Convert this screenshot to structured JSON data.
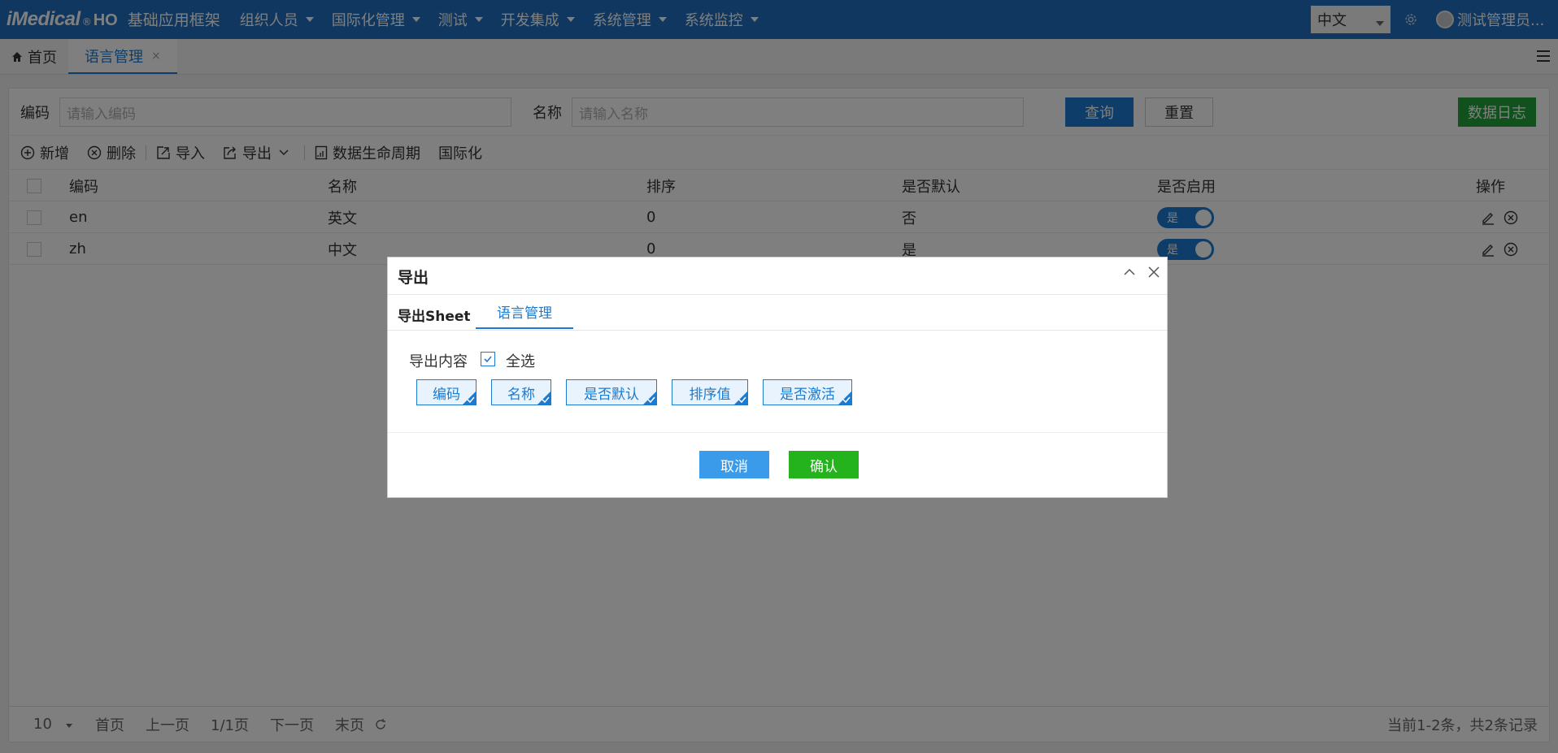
{
  "topbar": {
    "logo": "iMedical",
    "registered": "®",
    "product": "HO",
    "app_name": "基础应用框架",
    "menu": [
      {
        "label": "组织人员"
      },
      {
        "label": "国际化管理"
      },
      {
        "label": "测试"
      },
      {
        "label": "开发集成"
      },
      {
        "label": "系统管理"
      },
      {
        "label": "系统监控"
      }
    ],
    "language": "中文",
    "user": "测试管理员..."
  },
  "tabs": {
    "home": "首页",
    "active": "语言管理",
    "close": "×"
  },
  "search": {
    "code_label": "编码",
    "code_placeholder": "请输入编码",
    "name_label": "名称",
    "name_placeholder": "请输入名称",
    "query": "查询",
    "reset": "重置",
    "data_log": "数据日志"
  },
  "toolbar": {
    "add": "新增",
    "delete": "删除",
    "import": "导入",
    "export": "导出",
    "lifecycle": "数据生命周期",
    "i18n": "国际化"
  },
  "table": {
    "headers": {
      "code": "编码",
      "name": "名称",
      "sort": "排序",
      "is_default": "是否默认",
      "enabled": "是否启用",
      "actions": "操作"
    },
    "rows": [
      {
        "code": "en",
        "name": "英文",
        "sort": "0",
        "is_default": "否",
        "enabled": "是"
      },
      {
        "code": "zh",
        "name": "中文",
        "sort": "0",
        "is_default": "是",
        "enabled": "是"
      }
    ]
  },
  "pager": {
    "page_size": "10",
    "first": "首页",
    "prev": "上一页",
    "page": "1/1页",
    "next": "下一页",
    "last": "末页",
    "summary": "当前1-2条，共2条记录"
  },
  "dialog": {
    "title": "导出",
    "sheet_label": "导出Sheet",
    "sheet_tab": "语言管理",
    "content_label": "导出内容",
    "select_all": "全选",
    "fields": [
      "编码",
      "名称",
      "是否默认",
      "排序值",
      "是否激活"
    ],
    "cancel": "取消",
    "confirm": "确认"
  },
  "colors": {
    "header_blue": "#1f6fbf",
    "primary": "#1a7bd1",
    "success": "#21a33a",
    "dialog_cancel": "#3a9bea",
    "dialog_confirm": "#25b31d"
  }
}
